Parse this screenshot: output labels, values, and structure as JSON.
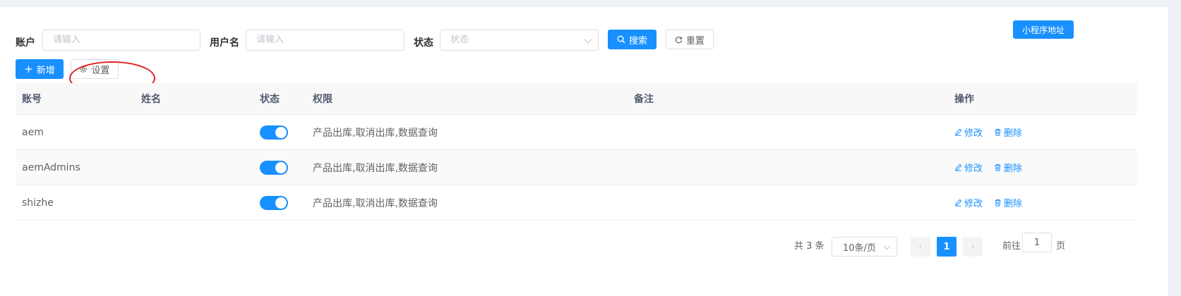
{
  "filters": {
    "account_label": "账户",
    "account_placeholder": "请输入",
    "username_label": "用户名",
    "username_placeholder": "请输入",
    "status_label": "状态",
    "status_placeholder": "状态",
    "search_label": "搜索",
    "reset_label": "重置"
  },
  "top_right_button": "小程序地址",
  "toolbar": {
    "add_label": "新增",
    "settings_label": "设置"
  },
  "table": {
    "headers": [
      "账号",
      "姓名",
      "状态",
      "权限",
      "备注",
      "操作"
    ],
    "rows": [
      {
        "account": "aem",
        "name": "",
        "enabled": true,
        "permissions": "产品出库,取消出库,数据查询",
        "remark": ""
      },
      {
        "account": "aemAdmins",
        "name": "",
        "enabled": true,
        "permissions": "产品出库,取消出库,数据查询",
        "remark": ""
      },
      {
        "account": "shizhe",
        "name": "",
        "enabled": true,
        "permissions": "产品出库,取消出库,数据查询",
        "remark": ""
      }
    ],
    "edit_label": "修改",
    "delete_label": "删除"
  },
  "pagination": {
    "total_text": "共 3 条",
    "page_size": "10条/页",
    "current_page": "1",
    "goto_prefix": "前往",
    "goto_value": "1",
    "goto_suffix": "页"
  },
  "colors": {
    "primary": "#1890ff",
    "annotation": "#e02020"
  }
}
